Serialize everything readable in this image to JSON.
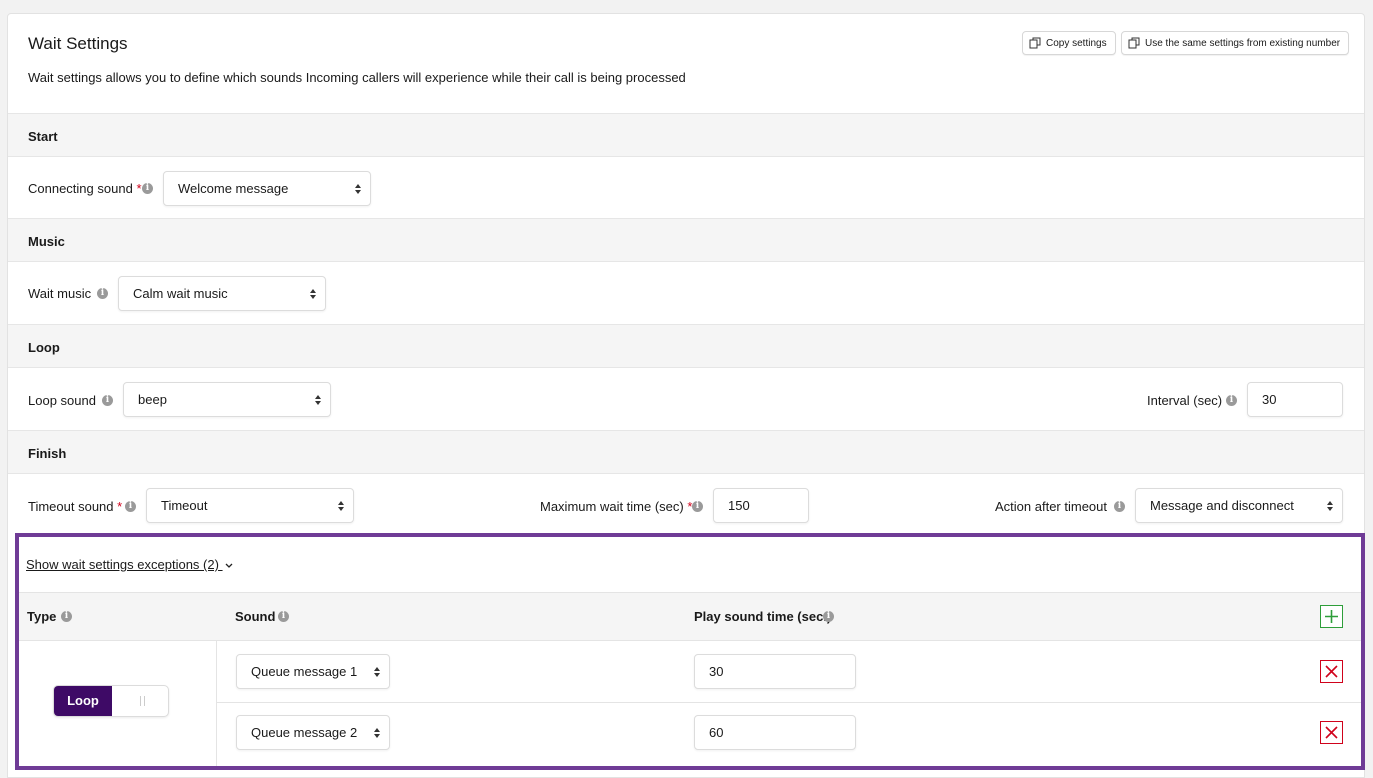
{
  "header": {
    "title": "Wait Settings",
    "description": "Wait settings allows you to define which sounds Incoming callers will experience while their call is being processed",
    "copy_settings_label": "Copy settings",
    "use_same_label": "Use the same settings from existing number",
    "copy_icon": "copy-icon"
  },
  "sections": {
    "start": "Start",
    "music": "Music",
    "loop": "Loop",
    "finish": "Finish"
  },
  "start": {
    "connecting_label": "Connecting sound",
    "required_mark": "*",
    "connecting_value": "Welcome message"
  },
  "music": {
    "wait_music_label": "Wait music",
    "wait_music_value": "Calm wait music"
  },
  "loop": {
    "loop_sound_label": "Loop sound",
    "loop_sound_value": "beep",
    "interval_label": "Interval (sec)",
    "interval_value": "30"
  },
  "finish": {
    "timeout_label": "Timeout sound",
    "timeout_value": "Timeout",
    "max_wait_label": "Maximum wait time (sec)",
    "max_wait_value": "150",
    "action_label": "Action after timeout",
    "action_value": "Message and disconnect",
    "required_mark": "*"
  },
  "exceptions": {
    "toggle_link": "Show wait settings exceptions (2)",
    "columns": {
      "type": "Type",
      "sound": "Sound",
      "play_time": "Play sound time (sec.)"
    },
    "type_toggle_label": "Loop",
    "rows": [
      {
        "sound": "Queue message 1",
        "time": "30"
      },
      {
        "sound": "Queue message 2",
        "time": "60"
      }
    ]
  },
  "colors": {
    "accent_purple": "#6f3b96",
    "toggle_on": "#3e0a66",
    "add_green": "#2e9e3a",
    "delete_red": "#d0021b"
  }
}
